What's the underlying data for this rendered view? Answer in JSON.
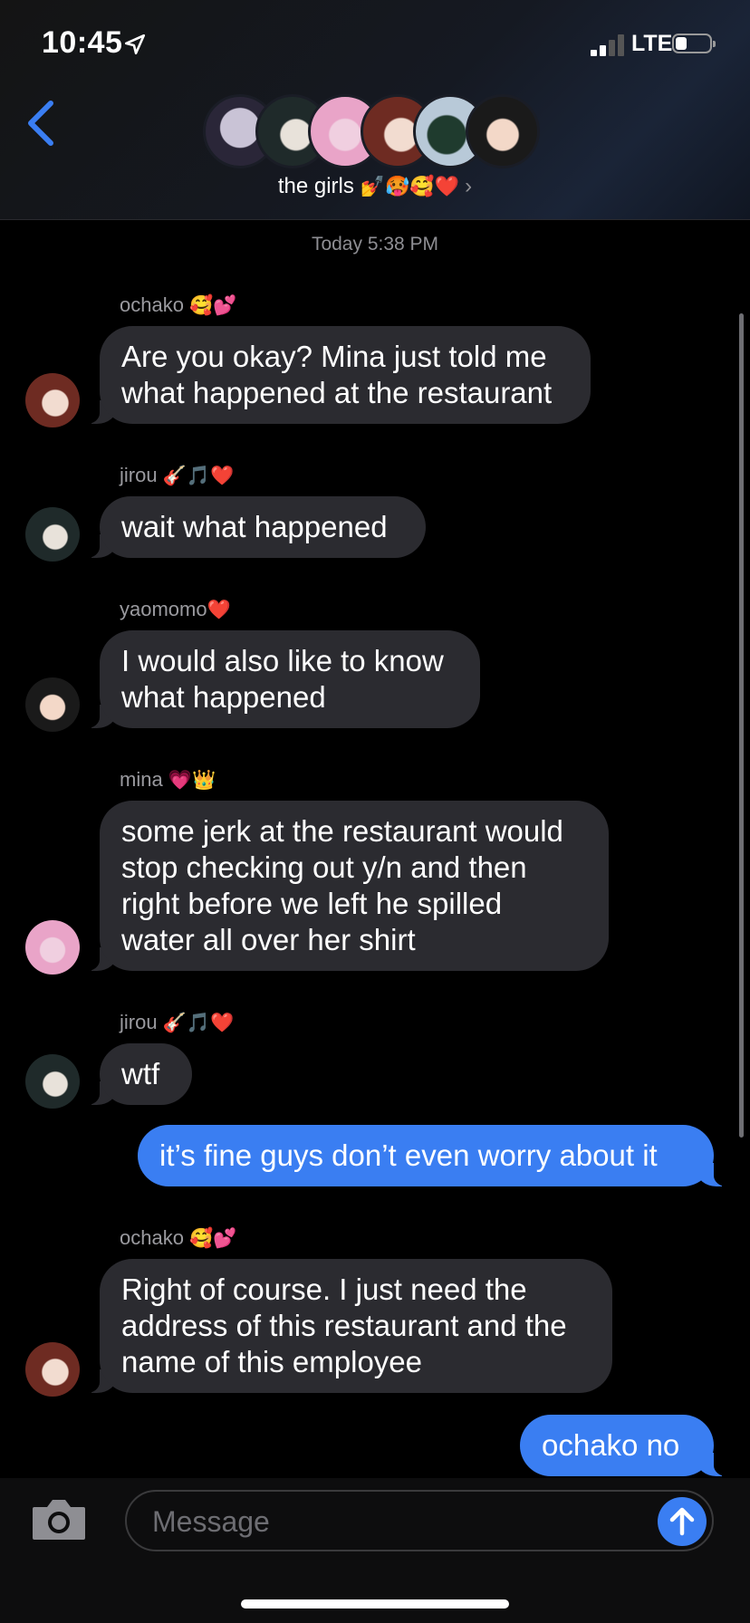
{
  "status": {
    "time": "10:45",
    "network": "LTE"
  },
  "header": {
    "group_name": "the girls",
    "group_emoji": "💅🥵🥰❤️",
    "chevron": "›"
  },
  "timestamp": "Today 5:38 PM",
  "messages": [
    {
      "sender": "ochako",
      "sender_emoji": "🥰💕",
      "text": "Are you okay? Mina just told me\nwhat happened at the restaurant"
    },
    {
      "sender": "jirou",
      "sender_emoji": "🎸🎵❤️",
      "text": "wait what happened"
    },
    {
      "sender": "yaomomo",
      "sender_emoji": "❤️",
      "text": "I would also like to know\nwhat happened"
    },
    {
      "sender": "mina",
      "sender_emoji": "💗👑",
      "text": "some jerk at the restaurant would\nstop checking out y/n and then\nright before we left he spilled\nwater all over her shirt"
    },
    {
      "sender": "jirou",
      "sender_emoji": "🎸🎵❤️",
      "text": "wtf"
    },
    {
      "sender": "me",
      "text": "it’s fine guys don’t even worry about it"
    },
    {
      "sender": "ochako",
      "sender_emoji": "🥰💕",
      "text": "Right of course. I just need the\naddress of this restaurant and the\nname of this employee"
    },
    {
      "sender": "me",
      "text": "ochako no"
    }
  ],
  "composer": {
    "placeholder": "Message"
  },
  "colors": {
    "outgoing": "#3a7ef2",
    "incoming": "#2b2b30",
    "accent": "#3a7ef2"
  },
  "icons": [
    "location-arrow-icon",
    "signal-icon",
    "battery-icon",
    "back-chevron-icon",
    "camera-icon",
    "send-arrow-icon"
  ]
}
